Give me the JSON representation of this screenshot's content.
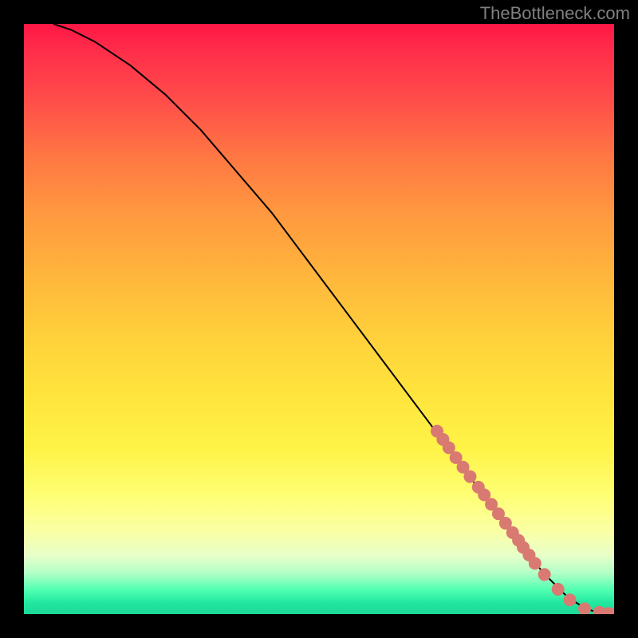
{
  "attribution": "TheBottleneck.com",
  "chart_data": {
    "type": "line",
    "title": "",
    "xlabel": "",
    "ylabel": "",
    "xlim": [
      0,
      100
    ],
    "ylim": [
      0,
      100
    ],
    "curve": {
      "name": "bottleneck-curve",
      "x": [
        5,
        8,
        12,
        18,
        24,
        30,
        36,
        42,
        48,
        54,
        60,
        66,
        72,
        78,
        84,
        88,
        92,
        95,
        98,
        100
      ],
      "y": [
        100,
        99,
        97,
        93,
        88,
        82,
        75,
        68,
        60,
        52,
        44,
        36,
        28,
        20,
        12,
        7,
        3,
        1,
        0,
        0
      ]
    },
    "markers": {
      "name": "highlighted-range",
      "color": "#d97a72",
      "points": [
        {
          "x": 70.0,
          "y": 31.0
        },
        {
          "x": 71.0,
          "y": 29.6
        },
        {
          "x": 72.0,
          "y": 28.2
        },
        {
          "x": 73.2,
          "y": 26.5
        },
        {
          "x": 74.4,
          "y": 24.9
        },
        {
          "x": 75.6,
          "y": 23.3
        },
        {
          "x": 77.0,
          "y": 21.5
        },
        {
          "x": 78.0,
          "y": 20.2
        },
        {
          "x": 79.2,
          "y": 18.6
        },
        {
          "x": 80.4,
          "y": 17.0
        },
        {
          "x": 81.6,
          "y": 15.4
        },
        {
          "x": 82.8,
          "y": 13.8
        },
        {
          "x": 83.8,
          "y": 12.5
        },
        {
          "x": 84.6,
          "y": 11.3
        },
        {
          "x": 85.6,
          "y": 10.0
        },
        {
          "x": 86.6,
          "y": 8.6
        },
        {
          "x": 88.2,
          "y": 6.7
        },
        {
          "x": 90.5,
          "y": 4.2
        },
        {
          "x": 92.5,
          "y": 2.4
        },
        {
          "x": 95.0,
          "y": 0.9
        },
        {
          "x": 97.5,
          "y": 0.3
        },
        {
          "x": 99.0,
          "y": 0.1
        },
        {
          "x": 100.0,
          "y": 0.0
        }
      ]
    }
  }
}
